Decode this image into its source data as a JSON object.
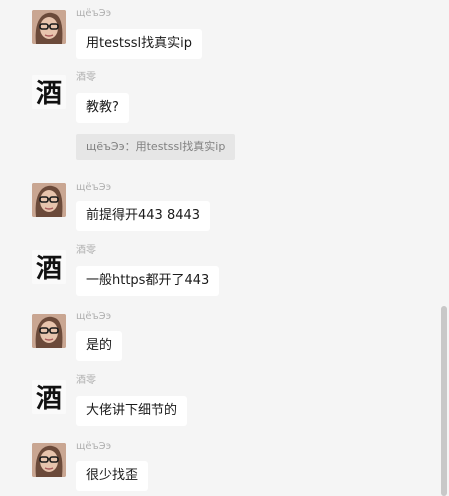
{
  "messages": [
    {
      "sender": "щёъЭэ",
      "avatar": "photo-avatar",
      "text": "用testssl找真实ip"
    },
    {
      "sender": "酒零",
      "avatar": "calligraphy-avatar",
      "avatar_char": "酒",
      "text": "教教?"
    },
    {
      "quote": "щёъЭэ：用testssl找真实ip"
    },
    {
      "sender": "щёъЭэ",
      "avatar": "photo-avatar",
      "text": "前提得开443 8443"
    },
    {
      "sender": "酒零",
      "avatar": "calligraphy-avatar",
      "avatar_char": "酒",
      "text": "一般https都开了443"
    },
    {
      "sender": "щёъЭэ",
      "avatar": "photo-avatar",
      "text": "是的"
    },
    {
      "sender": "酒零",
      "avatar": "calligraphy-avatar",
      "avatar_char": "酒",
      "text": "大佬讲下细节的"
    },
    {
      "sender": "щёъЭэ",
      "avatar": "photo-avatar",
      "text": "很少找歪"
    }
  ],
  "colors": {
    "background": "#f5f5f5",
    "bubble": "#ffffff",
    "quote_bg": "#e6e6e6",
    "sender_text": "#b0b0b0",
    "scrollbar": "#c8c8c8"
  }
}
